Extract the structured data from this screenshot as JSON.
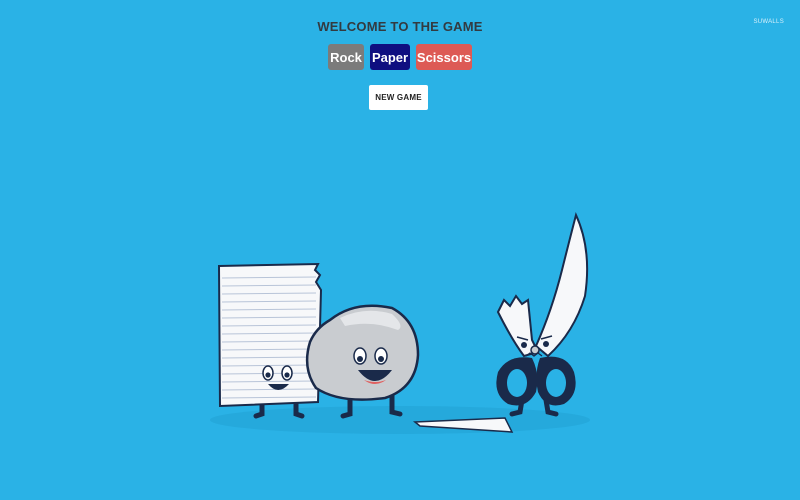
{
  "watermark": "SUWALLS",
  "game": {
    "title": "WELCOME TO THE GAME",
    "choices": {
      "rock": "Rock",
      "paper": "Paper",
      "scissors": "Scissors"
    },
    "new_game_label": "NEW GAME"
  },
  "colors": {
    "background": "#2ab2e6",
    "rock_button": "#7b7b7b",
    "paper_button": "#0f0f80",
    "scissors_button": "#dd5a55"
  },
  "illustration": {
    "characters": [
      "paper-character",
      "rock-character",
      "scissors-character",
      "cut-paper-strip"
    ]
  }
}
